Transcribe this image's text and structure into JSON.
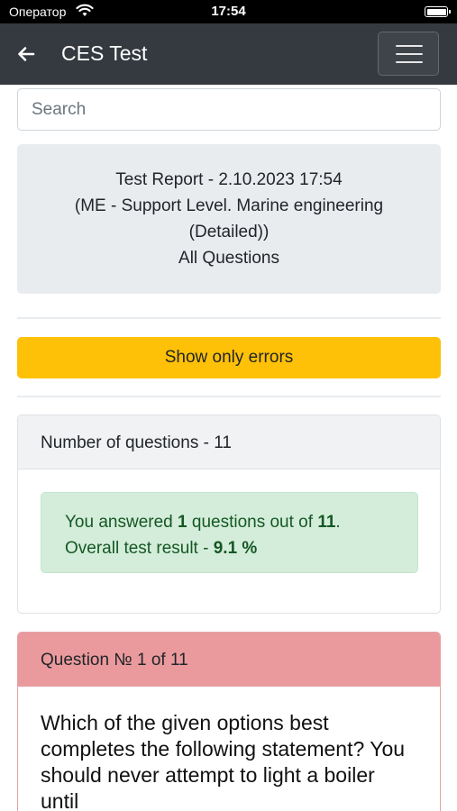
{
  "status_bar": {
    "carrier": "Оператор",
    "time": "17:54"
  },
  "navbar": {
    "title": "CES Test"
  },
  "search": {
    "placeholder": "Search"
  },
  "report": {
    "line1": "Test Report - 2.10.2023 17:54",
    "line2": "(ME - Support Level. Marine engineering",
    "line3": "(Detailed))",
    "line4": "All Questions"
  },
  "errors_button": {
    "label": "Show only errors"
  },
  "summary": {
    "header": "Number of questions - 11",
    "answered_prefix": "You answered ",
    "answered_count": "1",
    "answered_mid": " questions out of ",
    "total_count": "11",
    "answered_suffix": ".",
    "result_prefix": "Overall test result - ",
    "result_value": "9.1 %"
  },
  "question": {
    "header": "Question № 1 of 11",
    "text": "Which of the given options best completes the following statement? You should never attempt to light a boiler until ______"
  },
  "colors": {
    "navbar": "#343a40",
    "warning_button": "#ffc107",
    "success_bg": "#d4edda",
    "success_text": "#155724",
    "danger_header": "#ea9a9d"
  }
}
